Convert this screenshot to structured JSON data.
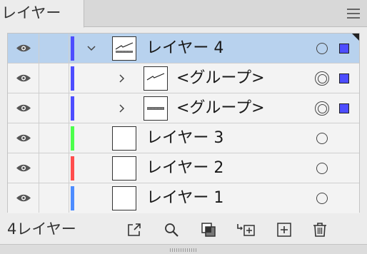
{
  "panel": {
    "tab_label": "レイヤー",
    "menu_icon": "hamburger-menu-icon"
  },
  "layers": [
    {
      "name": "レイヤー 4",
      "level": 0,
      "expanded": true,
      "selected": true,
      "color": "#4d4dff",
      "thumbnail": "artwork",
      "target": "single",
      "has_selection": true,
      "selection_color": "#4d4dff"
    },
    {
      "name": "<グループ>",
      "level": 1,
      "expanded": false,
      "selected": false,
      "color": "#4d4dff",
      "thumbnail": "artwork",
      "target": "double",
      "has_selection": true,
      "selection_color": "#4d4dff"
    },
    {
      "name": "<グループ>",
      "level": 1,
      "expanded": false,
      "selected": false,
      "color": "#4d4dff",
      "thumbnail": "artwork",
      "target": "double",
      "has_selection": true,
      "selection_color": "#4d4dff"
    },
    {
      "name": "レイヤー 3",
      "level": 0,
      "expanded": false,
      "selected": false,
      "color": "#4cff4c",
      "thumbnail": "blank",
      "target": "single",
      "has_selection": false
    },
    {
      "name": "レイヤー 2",
      "level": 0,
      "expanded": false,
      "selected": false,
      "color": "#ff4d4d",
      "thumbnail": "blank",
      "target": "single",
      "has_selection": false
    },
    {
      "name": "レイヤー 1",
      "level": 0,
      "expanded": false,
      "selected": false,
      "color": "#4d8cff",
      "thumbnail": "blank",
      "target": "single",
      "has_selection": false
    }
  ],
  "footer": {
    "layer_count": "4レイヤー",
    "buttons": [
      "export-icon",
      "search-icon",
      "clipping-mask-icon",
      "new-sublayer-icon",
      "new-layer-icon",
      "trash-icon"
    ]
  }
}
